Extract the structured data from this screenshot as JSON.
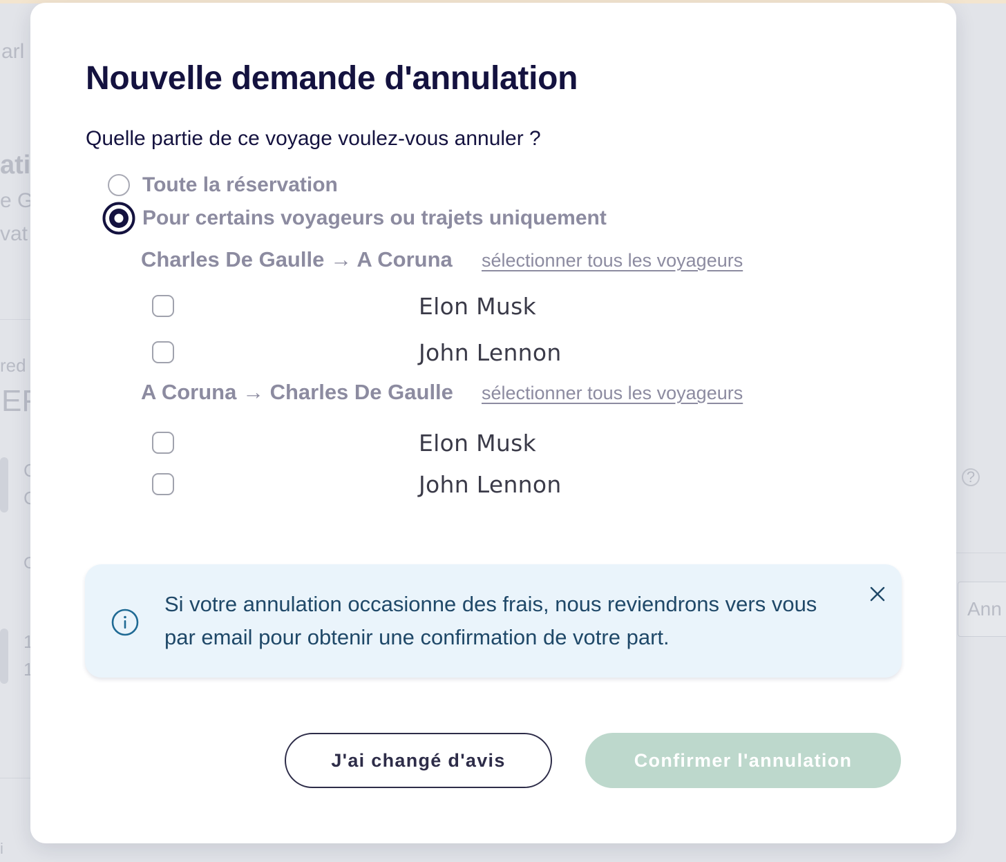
{
  "background": {
    "fragments": [
      "arl",
      "ati",
      "e G",
      "vat",
      "red",
      "EF",
      "C",
      "C",
      "C",
      "1",
      "1",
      "Ann",
      "?",
      "i"
    ]
  },
  "modal": {
    "title": "Nouvelle demande d'annulation",
    "question": "Quelle partie de ce voyage voulez-vous annuler ?",
    "options": [
      {
        "label": "Toute la réservation",
        "selected": false
      },
      {
        "label": "Pour certains voyageurs ou trajets uniquement",
        "selected": true
      }
    ],
    "routes": [
      {
        "name": "Charles De Gaulle → A Coruna",
        "select_all": "sélectionner tous les voyageurs",
        "travellers": [
          {
            "name": "Elon Musk",
            "checked": false
          },
          {
            "name": "John Lennon",
            "checked": false
          }
        ]
      },
      {
        "name": "A Coruna → Charles De Gaulle",
        "select_all": "sélectionner tous les voyageurs",
        "travellers": [
          {
            "name": "Elon Musk",
            "checked": false
          },
          {
            "name": "John Lennon",
            "checked": false
          }
        ]
      }
    ],
    "info": {
      "icon": "info-circle-icon",
      "line1": "Si votre annulation occasionne des frais, nous reviendrons vers vous",
      "line2": "par email pour obtenir une confirmation de votre part."
    },
    "buttons": {
      "cancel": "J'ai changé d'avis",
      "confirm": "Confirmer l'annulation"
    }
  },
  "colors": {
    "primary": "#14123f",
    "muted_text": "#8c8ba0",
    "info_bg": "#eaf4fb",
    "info_text": "#1f4868",
    "confirm_disabled": "#bdd8cc"
  }
}
